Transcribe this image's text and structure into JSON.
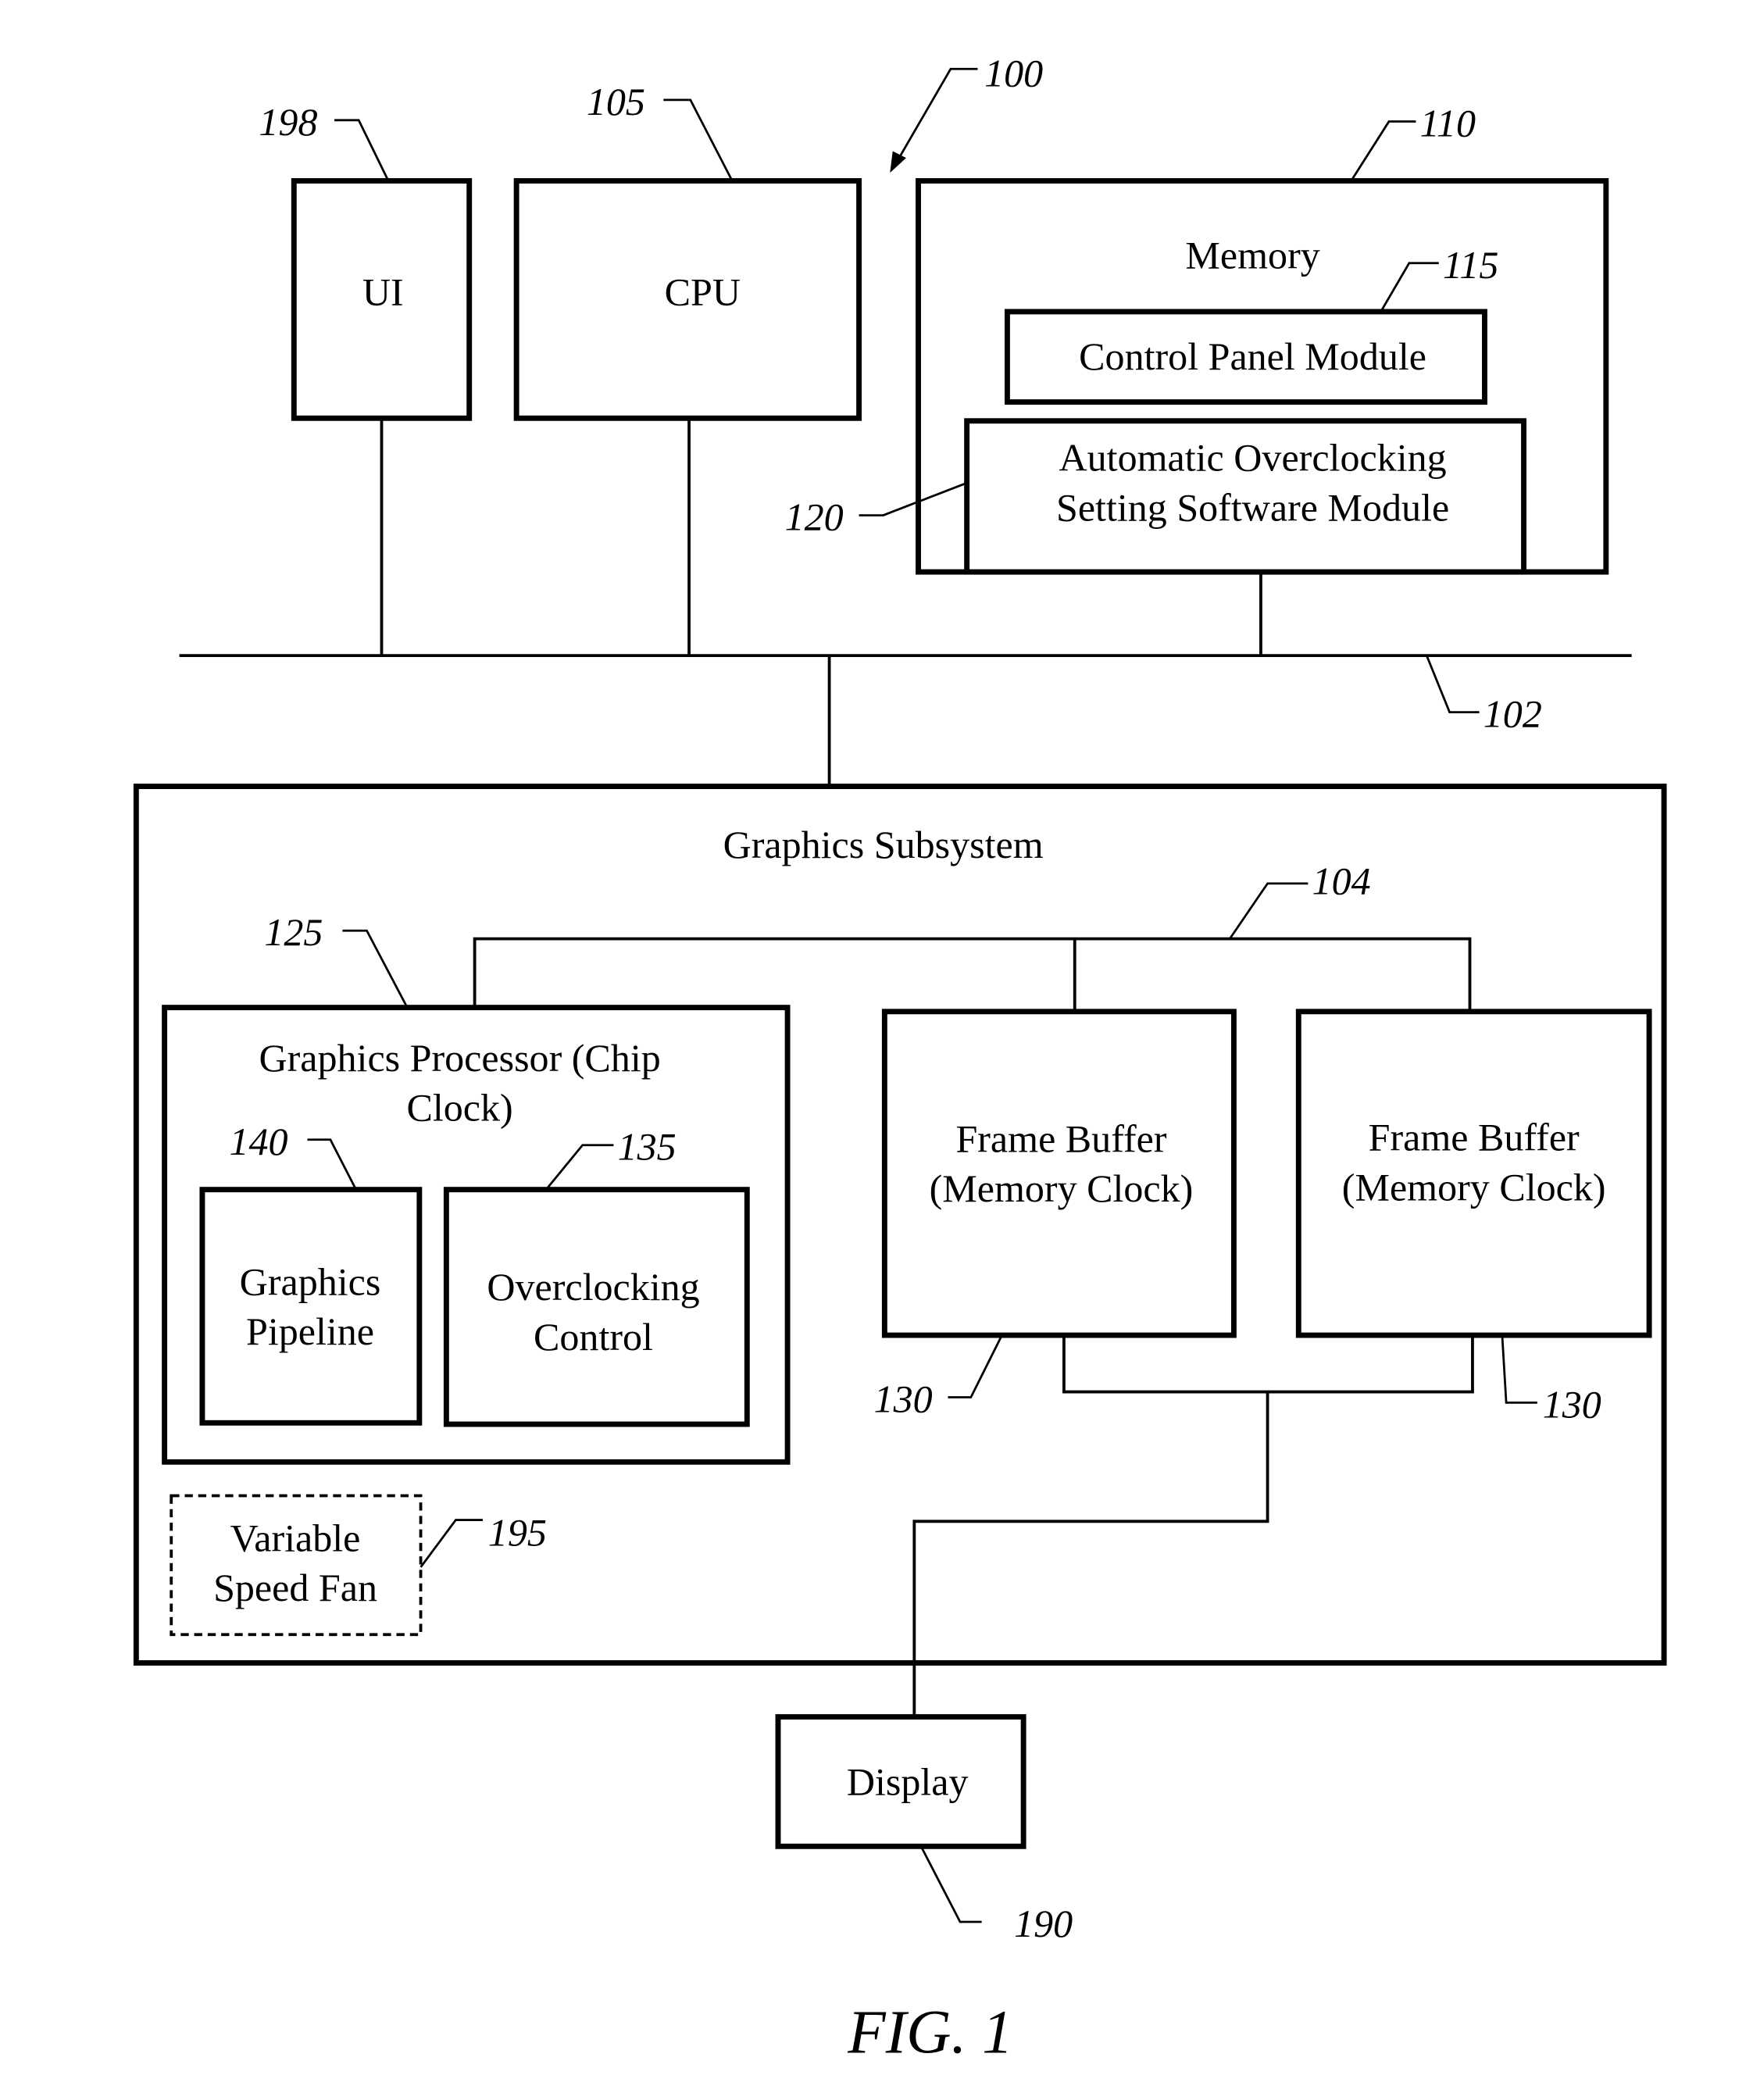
{
  "figure": {
    "caption": "FIG. 1",
    "system_ref": "100"
  },
  "blocks": {
    "ui": {
      "label": "UI",
      "ref": "198"
    },
    "cpu": {
      "label": "CPU",
      "ref": "105"
    },
    "memory": {
      "label": "Memory",
      "ref": "110"
    },
    "control_panel": {
      "label": "Control Panel Module",
      "ref": "115"
    },
    "auto_oc": {
      "line1": "Automatic Overclocking",
      "line2": "Setting Software Module",
      "ref": "120"
    },
    "system_bus": {
      "ref": "102"
    },
    "graphics_subsystem": {
      "label": "Graphics Subsystem"
    },
    "local_bus": {
      "ref": "104"
    },
    "graphics_processor": {
      "line1": "Graphics Processor (Chip",
      "line2": "Clock)",
      "ref": "125"
    },
    "graphics_pipeline": {
      "line1": "Graphics",
      "line2": "Pipeline",
      "ref": "140"
    },
    "overclocking_control": {
      "line1": "Overclocking",
      "line2": "Control",
      "ref": "135"
    },
    "frame_buffer_1": {
      "line1": "Frame Buffer",
      "line2": "(Memory Clock)",
      "ref": "130"
    },
    "frame_buffer_2": {
      "line1": "Frame Buffer",
      "line2": "(Memory Clock)",
      "ref": "130"
    },
    "fan": {
      "line1": "Variable",
      "line2": "Speed Fan",
      "ref": "195"
    },
    "display": {
      "label": "Display",
      "ref": "190"
    }
  }
}
